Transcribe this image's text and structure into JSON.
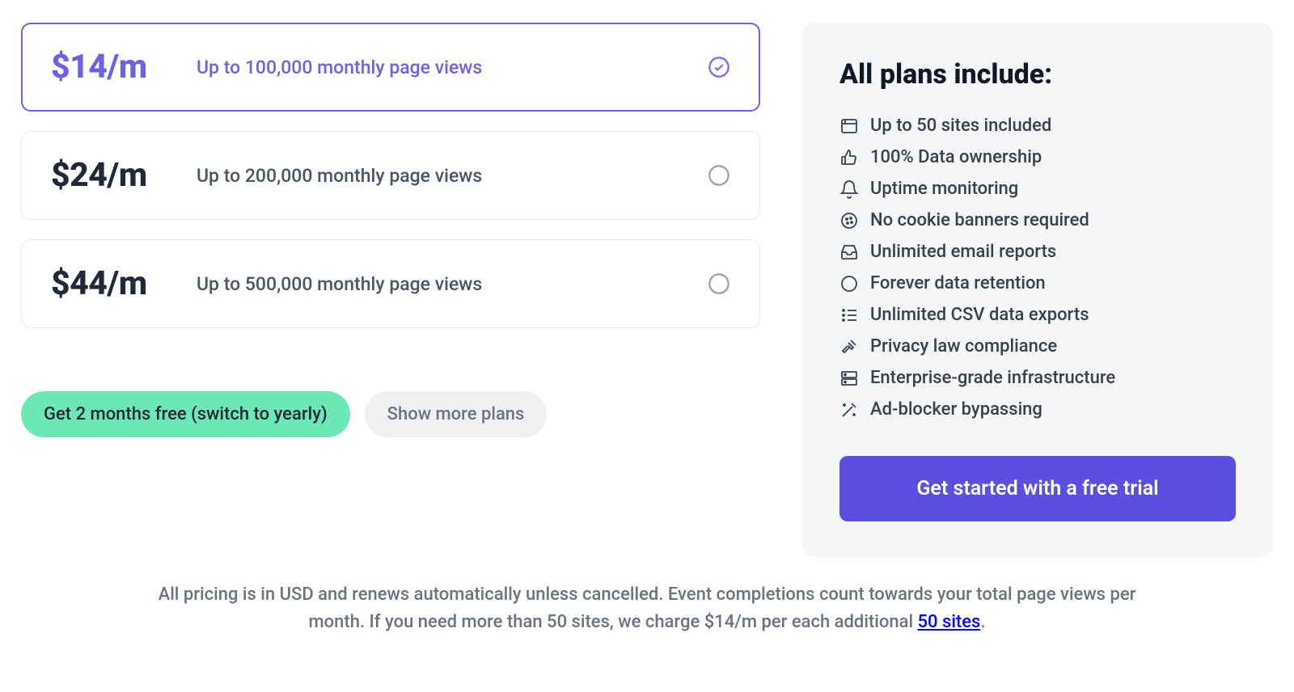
{
  "plans": [
    {
      "price": "$14/m",
      "desc": "Up to 100,000 monthly page views",
      "selected": true
    },
    {
      "price": "$24/m",
      "desc": "Up to 200,000 monthly page views",
      "selected": false
    },
    {
      "price": "$44/m",
      "desc": "Up to 500,000 monthly page views",
      "selected": false
    }
  ],
  "actions": {
    "yearly_switch": "Get 2 months free (switch to yearly)",
    "show_more": "Show more plans"
  },
  "features": {
    "title": "All plans include:",
    "items": [
      "Up to 50 sites included",
      "100% Data ownership",
      "Uptime monitoring",
      "No cookie banners required",
      "Unlimited email reports",
      "Forever data retention",
      "Unlimited CSV data exports",
      "Privacy law compliance",
      "Enterprise-grade infrastructure",
      "Ad-blocker bypassing"
    ]
  },
  "cta": "Get started with a free trial",
  "footer": {
    "line1": "All pricing is in USD and renews automatically unless cancelled. Event completions count towards your total page views per",
    "line2_a": "month. If you need more than 50 sites, we charge $14/m per each additional ",
    "line2_link": "50 sites",
    "line2_b": "."
  }
}
